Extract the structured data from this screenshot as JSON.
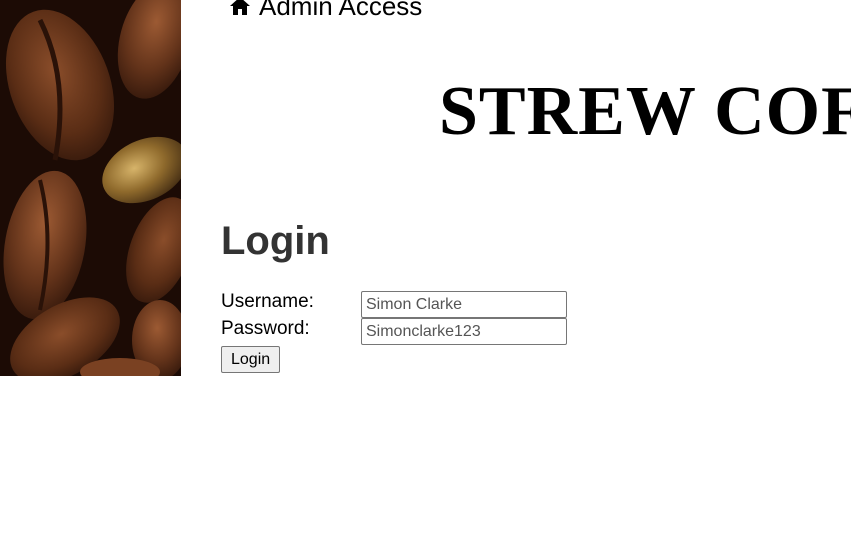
{
  "header": {
    "nav_label": "Admin Access",
    "nav_icon": "home-icon",
    "brand_title": "STREW COFFEE"
  },
  "login": {
    "title": "Login",
    "username_label": "Username:",
    "username_value": "Simon Clarke",
    "password_label": "Password:",
    "password_value": "Simonclarke123",
    "submit_label": "Login"
  },
  "colors": {
    "heading": "#333333",
    "bean_dark": "#2a140a",
    "bean_mid": "#6b3a1f"
  }
}
